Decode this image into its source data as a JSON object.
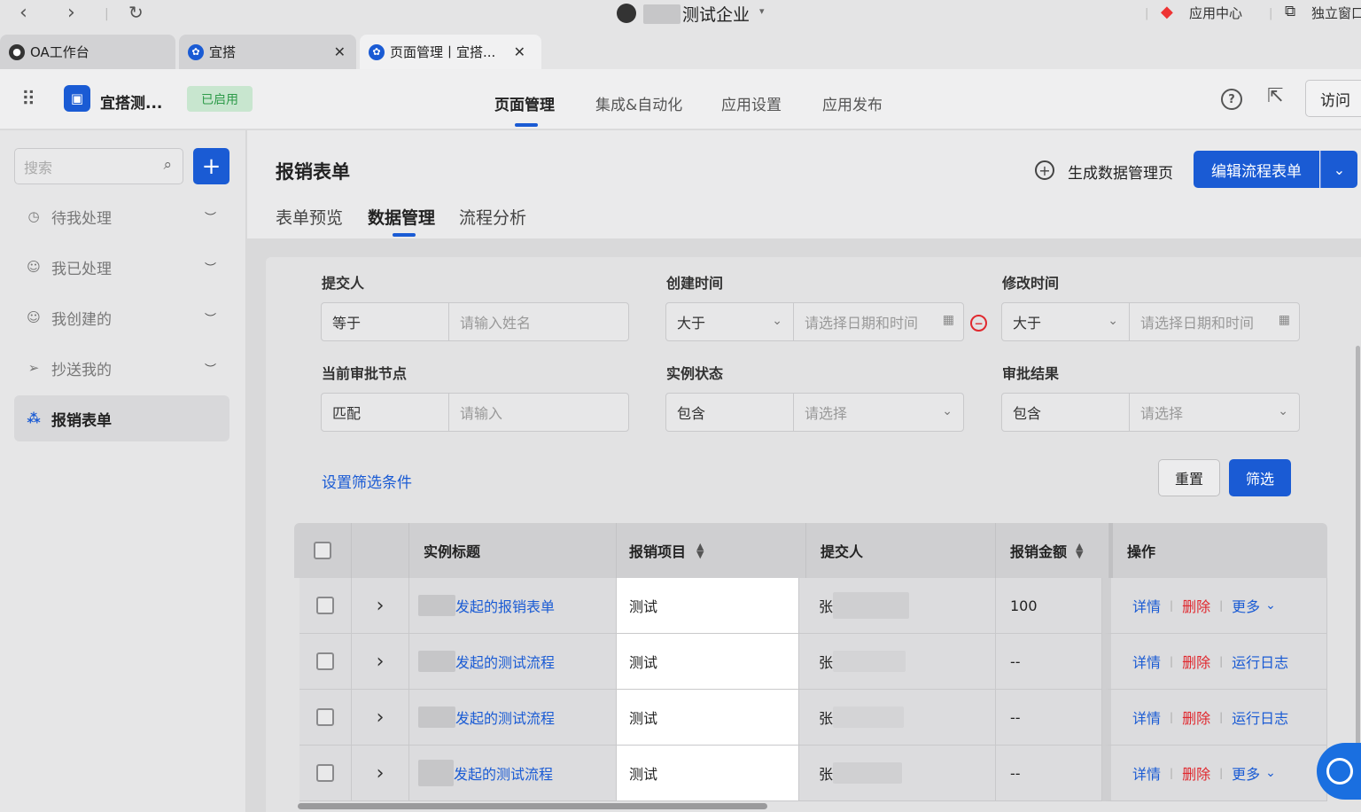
{
  "browser": {
    "company": "测试企业",
    "app_center": "应用中心",
    "standalone": "独立窗口",
    "tabs": [
      {
        "label": "OA工作台"
      },
      {
        "label": "宜搭"
      },
      {
        "label": "页面管理丨宜搭..."
      }
    ]
  },
  "app_header": {
    "app_name": "宜搭测...",
    "status_badge": "已启用",
    "nav": [
      "页面管理",
      "集成&自动化",
      "应用设置",
      "应用发布"
    ],
    "visit_label": "访问"
  },
  "sidebar": {
    "search_placeholder": "搜索",
    "items": [
      {
        "label": "待我处理",
        "icon": "clock-icon"
      },
      {
        "label": "我已处理",
        "icon": "user-check-icon"
      },
      {
        "label": "我创建的",
        "icon": "user-add-icon"
      },
      {
        "label": "抄送我的",
        "icon": "send-icon"
      },
      {
        "label": "报销表单",
        "icon": "org-chart-icon"
      }
    ]
  },
  "page": {
    "title": "报销表单",
    "generate_label": "生成数据管理页",
    "edit_label": "编辑流程表单",
    "subtabs": [
      "表单预览",
      "数据管理",
      "流程分析"
    ]
  },
  "filters": {
    "submitter": {
      "label": "提交人",
      "op": "等于",
      "placeholder": "请输入姓名"
    },
    "created": {
      "label": "创建时间",
      "op": "大于",
      "placeholder": "请选择日期和时间"
    },
    "modified": {
      "label": "修改时间",
      "op": "大于",
      "placeholder": "请选择日期和时间"
    },
    "node": {
      "label": "当前审批节点",
      "op": "匹配",
      "placeholder": "请输入"
    },
    "state": {
      "label": "实例状态",
      "op": "包含",
      "placeholder": "请选择"
    },
    "result": {
      "label": "审批结果",
      "op": "包含",
      "placeholder": "请选择"
    },
    "set_conditions": "设置筛选条件",
    "reset": "重置",
    "filter": "筛选"
  },
  "table": {
    "headers": [
      "实例标题",
      "报销项目",
      "提交人",
      "报销金额",
      "操作"
    ],
    "rows": [
      {
        "title": "发起的报销表单",
        "item": "测试",
        "submitter": "张",
        "amount": "100",
        "actions": [
          "详情",
          "删除",
          "更多"
        ]
      },
      {
        "title": "发起的测试流程",
        "item": "测试",
        "submitter": "张",
        "amount": "--",
        "actions": [
          "详情",
          "删除",
          "运行日志"
        ]
      },
      {
        "title": "发起的测试流程",
        "item": "测试",
        "submitter": "张",
        "amount": "--",
        "actions": [
          "详情",
          "删除",
          "运行日志"
        ]
      },
      {
        "title": "发起的测试流程",
        "item": "测试",
        "submitter": "张",
        "amount": "--",
        "actions": [
          "详情",
          "删除",
          "更多"
        ]
      }
    ]
  },
  "colors": {
    "primary": "#1a5bd4",
    "danger": "#e0282e",
    "badge_green": "#2e9b4a"
  }
}
